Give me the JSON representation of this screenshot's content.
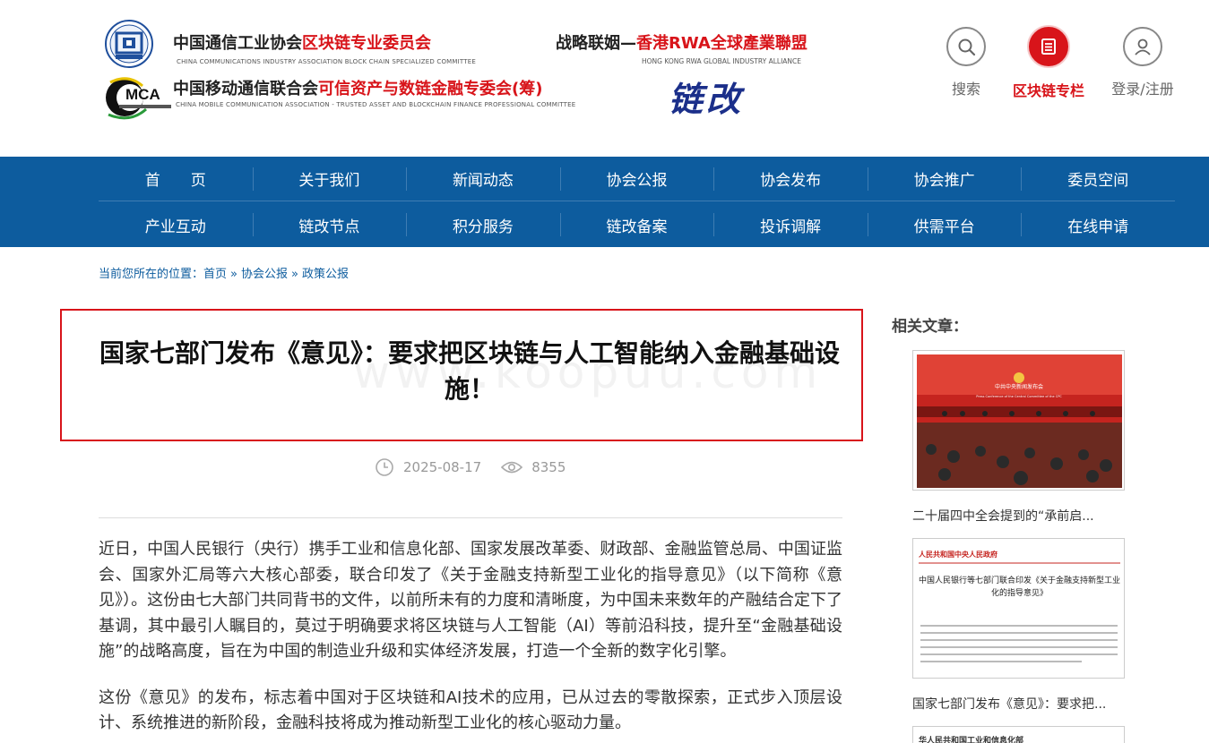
{
  "header": {
    "org1_cn_black": "中国通信工业协会",
    "org1_cn_red": "区块链专业委员会",
    "org1_en": "CHINA COMMUNICATIONS INDUSTRY ASSOCIATION BLOCK CHAIN SPECIALIZED COMMITTEE",
    "org2_cn_black": "中国移动通信联合会",
    "org2_cn_red": "可信资产与数链金融专委会(筹)",
    "org2_en": "CHINA MOBILE COMMUNICATION ASSOCIATION - TRUSTED ASSET AND BLOCKCHAIN FINANCE PROFESSIONAL COMMITTEE",
    "logo2_text": "MCA",
    "alliance_cn_black": "战略联姻—",
    "alliance_cn_red": "香港RWA全球產業聯盟",
    "alliance_en": "HONG KONG RWA GLOBAL INDUSTRY ALLIANCE",
    "brand_art": "链改",
    "tools": {
      "search_label": "搜索",
      "column_label": "区块链专栏",
      "login_label": "登录/注册"
    }
  },
  "nav": {
    "row1": [
      "首　　页",
      "关于我们",
      "新闻动态",
      "协会公报",
      "协会发布",
      "协会推广",
      "委员空间"
    ],
    "row2": [
      "产业互动",
      "链改节点",
      "积分服务",
      "链改备案",
      "投诉调解",
      "供需平台",
      "在线申请"
    ]
  },
  "breadcrumb": {
    "prefix": "当前您所在的位置：",
    "items": [
      "首页",
      "协会公报",
      "政策公报"
    ],
    "separator": "»"
  },
  "article": {
    "watermark": "www.koopuu.com",
    "title": "国家七部门发布《意见》：要求把区块链与人工智能纳入金融基础设施！",
    "date": "2025-08-17",
    "views": "8355",
    "paragraphs": [
      "近日，中国人民银行（央行）携手工业和信息化部、国家发展改革委、财政部、金融监管总局、中国证监会、国家外汇局等六大核心部委，联合印发了《关于金融支持新型工业化的指导意见》（以下简称《意见》）。这份由七大部门共同背书的文件，以前所未有的力度和清晰度，为中国未来数年的产融结合定下了基调，其中最引人瞩目的，莫过于明确要求将区块链与人工智能（AI）等前沿科技，提升至“金融基础设施”的战略高度，旨在为中国的制造业升级和实体经济发展，打造一个全新的数字化引擎。",
      "这份《意见》的发布，标志着中国对于区块链和AI技术的应用，已从过去的零散探索，正式步入顶层设计、系统推进的新阶段，金融科技将成为推动新型工业化的核心驱动力量。"
    ]
  },
  "sidebar": {
    "title": "相关文章：",
    "items": [
      {
        "caption": "二十届四中全会提到的“承前启...",
        "thumb_banner": "中共中央新闻发布会",
        "thumb_sub": "Press Conference of the Central Committee of the CPC"
      },
      {
        "caption": "国家七部门发布《意见》：要求把...",
        "thumb_source": "人民共和国中央人民政府",
        "thumb_heading": "中国人民银行等七部门联合印发《关于金融支持新型工业化的指导意见》"
      },
      {
        "thumb_source": "华人民共和国工业和信息化部"
      }
    ]
  },
  "colors": {
    "nav_blue": "#0d5c9e",
    "accent_red": "#d8141a",
    "brand_navy": "#1b2f8a"
  }
}
